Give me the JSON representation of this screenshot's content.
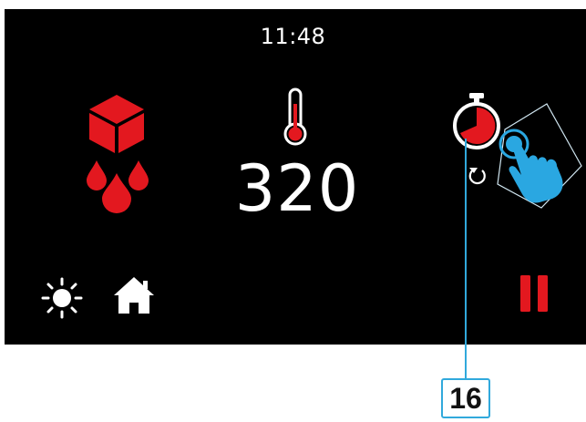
{
  "status": {
    "time": "11:48"
  },
  "main": {
    "temperature": "320"
  },
  "icons": {
    "steam": "steam-humidity-icon",
    "thermometer": "thermometer-icon",
    "timer": "timer-icon",
    "reset": "timer-reset-icon",
    "touch": "touch-tap-hand-icon",
    "light": "light-sun-icon",
    "home": "home-icon",
    "pause": "pause-icon"
  },
  "colors": {
    "accent_red": "#e3181f",
    "background": "#000000",
    "callout_blue": "#31a9dc",
    "hand_blue": "#2aa7e1"
  },
  "callout": {
    "label": "16"
  }
}
